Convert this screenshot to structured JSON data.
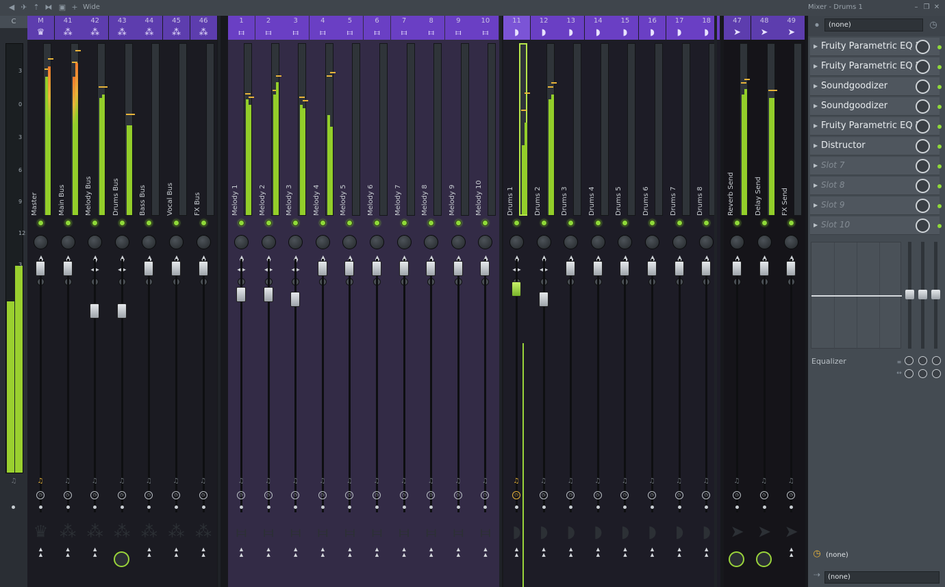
{
  "toolbar": {
    "mode_label": "Wide",
    "window_title": "Mixer - Drums 1",
    "minimize": "–",
    "restore": "❐",
    "close": "✕"
  },
  "master": {
    "label": "C",
    "ticks": [
      "3",
      "0",
      "3",
      "6",
      "9",
      "12",
      "3"
    ]
  },
  "groups": [
    {
      "id": "g1",
      "color": "#5d3dae",
      "stripbg": "#1b1b22",
      "icon": "wave",
      "strips": [
        {
          "num": "M",
          "name": "Master",
          "icon": "crown",
          "fader": 0.8,
          "meter": [
            0.8,
            0.86
          ],
          "peak": [
            0.84,
            0.9
          ]
        },
        {
          "num": "41",
          "name": "Main Bus",
          "icon": "wave",
          "fader": 0.8,
          "meter": [
            0.8,
            0.88
          ],
          "peak": [
            0.88,
            0.95
          ]
        },
        {
          "num": "42",
          "name": "Melody Bus",
          "icon": "wave",
          "fader": 0.55,
          "meter": [
            0.68,
            0.7
          ],
          "peak": [
            0.74,
            0.74
          ]
        },
        {
          "num": "43",
          "name": "Drums Bus",
          "icon": "wave",
          "fader": 0.55,
          "meter": [
            0.52,
            0.52
          ],
          "peak": [
            0.58,
            0.58
          ]
        },
        {
          "num": "44",
          "name": "Bass Bus",
          "icon": "wave",
          "fader": 0.8,
          "meter": [
            0,
            0
          ],
          "peak": [
            0,
            0
          ]
        },
        {
          "num": "45",
          "name": "Vocal Bus",
          "icon": "wave",
          "fader": 0.8,
          "meter": [
            0,
            0
          ],
          "peak": [
            0,
            0
          ]
        },
        {
          "num": "46",
          "name": "FX Bus",
          "icon": "wave",
          "fader": 0.8,
          "meter": [
            0,
            0
          ],
          "peak": [
            0,
            0
          ]
        }
      ]
    },
    {
      "id": "g2",
      "color": "#6a3fc4",
      "stripbg": "#332b46",
      "icon": "keys",
      "strips": [
        {
          "num": "1",
          "name": "Melody 1",
          "icon": "keys",
          "fader": 0.65,
          "meter": [
            0.67,
            0.64
          ],
          "peak": [
            0.7,
            0.68
          ]
        },
        {
          "num": "2",
          "name": "Melody 2",
          "icon": "keys",
          "fader": 0.65,
          "meter": [
            0.7,
            0.77
          ],
          "peak": [
            0.72,
            0.8
          ]
        },
        {
          "num": "3",
          "name": "Melody 3",
          "icon": "keys",
          "fader": 0.62,
          "meter": [
            0.64,
            0.62
          ],
          "peak": [
            0.68,
            0.66
          ]
        },
        {
          "num": "4",
          "name": "Melody 4",
          "icon": "keys",
          "fader": 0.8,
          "meter": [
            0.58,
            0.51
          ],
          "peak": [
            0.8,
            0.82
          ]
        },
        {
          "num": "5",
          "name": "Melody 5",
          "icon": "keys",
          "fader": 0.8,
          "meter": [
            0,
            0
          ],
          "peak": [
            0,
            0
          ]
        },
        {
          "num": "6",
          "name": "Melody 6",
          "icon": "keys",
          "fader": 0.8,
          "meter": [
            0,
            0
          ],
          "peak": [
            0,
            0
          ]
        },
        {
          "num": "7",
          "name": "Melody 7",
          "icon": "keys",
          "fader": 0.8,
          "meter": [
            0,
            0
          ],
          "peak": [
            0,
            0
          ]
        },
        {
          "num": "8",
          "name": "Melody 8",
          "icon": "keys",
          "fader": 0.8,
          "meter": [
            0,
            0
          ],
          "peak": [
            0,
            0
          ]
        },
        {
          "num": "9",
          "name": "Melody 9",
          "icon": "keys",
          "fader": 0.8,
          "meter": [
            0,
            0
          ],
          "peak": [
            0,
            0
          ]
        },
        {
          "num": "10",
          "name": "Melody 10",
          "icon": "keys",
          "fader": 0.8,
          "meter": [
            0,
            0
          ],
          "peak": [
            0,
            0
          ]
        }
      ]
    },
    {
      "id": "g3",
      "color": "#6a3fc4",
      "stripbg": "#1d1c26",
      "icon": "drum",
      "strips": [
        {
          "num": "11",
          "name": "Drums 1",
          "icon": "drum",
          "fader": 0.68,
          "meter": [
            0.4,
            0.53
          ],
          "peak": [
            0.6,
            0.7
          ],
          "selected": true
        },
        {
          "num": "12",
          "name": "Drums 2",
          "icon": "drum",
          "fader": 0.62,
          "meter": [
            0.67,
            0.7
          ],
          "peak": [
            0.74,
            0.76
          ]
        },
        {
          "num": "13",
          "name": "Drums 3",
          "icon": "drum",
          "fader": 0.8,
          "meter": [
            0,
            0
          ],
          "peak": [
            0,
            0
          ]
        },
        {
          "num": "14",
          "name": "Drums 4",
          "icon": "drum",
          "fader": 0.8,
          "meter": [
            0,
            0
          ],
          "peak": [
            0,
            0
          ]
        },
        {
          "num": "15",
          "name": "Drums 5",
          "icon": "drum",
          "fader": 0.8,
          "meter": [
            0,
            0
          ],
          "peak": [
            0,
            0
          ]
        },
        {
          "num": "16",
          "name": "Drums 6",
          "icon": "drum",
          "fader": 0.8,
          "meter": [
            0,
            0
          ],
          "peak": [
            0,
            0
          ]
        },
        {
          "num": "17",
          "name": "Drums 7",
          "icon": "drum",
          "fader": 0.8,
          "meter": [
            0,
            0
          ],
          "peak": [
            0,
            0
          ]
        },
        {
          "num": "18",
          "name": "Drums 8",
          "icon": "drum",
          "fader": 0.8,
          "meter": [
            0,
            0
          ],
          "peak": [
            0,
            0
          ]
        }
      ]
    },
    {
      "id": "g4",
      "color": "#5d3dae",
      "stripbg": "#151419",
      "icon": "send",
      "strips": [
        {
          "num": "47",
          "name": "Reverb Send",
          "icon": "send",
          "fader": 0.8,
          "meter": [
            0.7,
            0.73
          ],
          "peak": [
            0.76,
            0.78
          ]
        },
        {
          "num": "48",
          "name": "Delay Send",
          "icon": "send",
          "fader": 0.8,
          "meter": [
            0.68,
            0.68
          ],
          "peak": [
            0.72,
            0.72
          ]
        },
        {
          "num": "49",
          "name": "FX Send",
          "icon": "send",
          "fader": 0.8,
          "meter": [
            0,
            0
          ],
          "peak": [
            0,
            0
          ]
        }
      ]
    }
  ],
  "side": {
    "input": "(none)",
    "slots": [
      {
        "label": "Fruity Parametric EQ 2",
        "active": true
      },
      {
        "label": "Fruity Parametric EQ 2",
        "active": true
      },
      {
        "label": "Soundgoodizer",
        "active": true
      },
      {
        "label": "Soundgoodizer",
        "active": true
      },
      {
        "label": "Fruity Parametric EQ 2",
        "active": true
      },
      {
        "label": "Distructor",
        "active": true
      },
      {
        "label": "Slot 7",
        "active": false
      },
      {
        "label": "Slot 8",
        "active": false
      },
      {
        "label": "Slot 9",
        "active": false
      },
      {
        "label": "Slot 10",
        "active": false
      }
    ],
    "eq_label": "Equalizer",
    "eq_level": 0.5,
    "bottom_in": "(none)",
    "bottom_out": "(none)"
  },
  "colors": {
    "accent": "#8fd93a",
    "header": "#6a3fc4"
  }
}
